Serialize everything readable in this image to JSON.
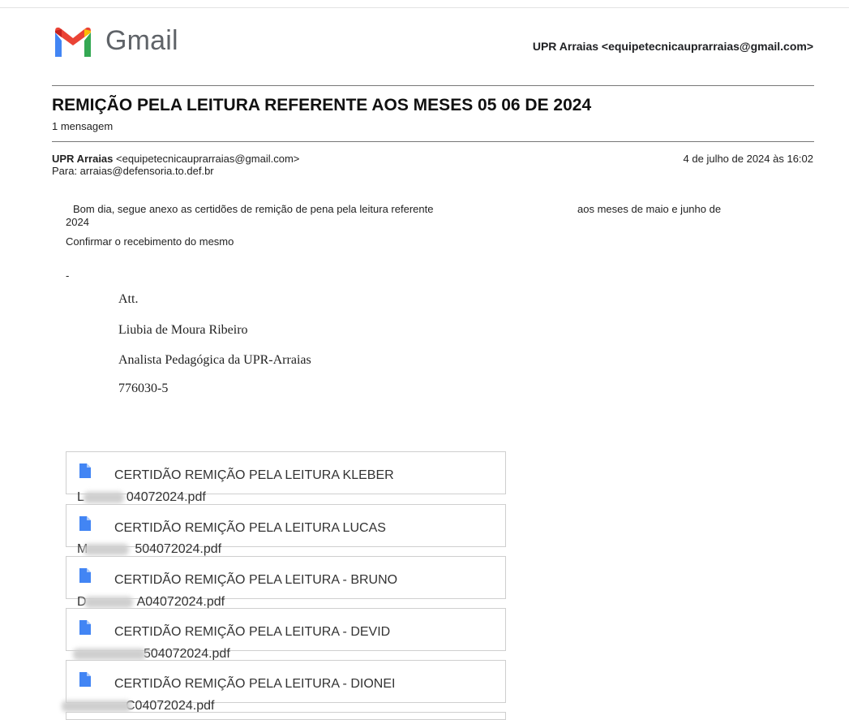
{
  "app": {
    "logo_text": "Gmail",
    "account": "UPR Arraias <equipetecnicauprarraias@gmail.com>"
  },
  "thread": {
    "subject": "REMIÇÃO PELA LEITURA REFERENTE AOS MESES 05 06 DE 2024",
    "count": "1 mensagem"
  },
  "message": {
    "sender_name": "UPR Arraias",
    "sender_email": "<equipetecnicauprarraias@gmail.com>",
    "to": "Para: arraias@defensoria.to.def.br",
    "date": "4 de julho de 2024 às 16:02",
    "body": {
      "line1a": "Bom dia, segue anexo as certidões de remição de pena pela leitura referente",
      "line1b": "aos meses de maio e junho de",
      "line2": "2024",
      "line3": "Confirmar o recebimento do mesmo",
      "dash": "-"
    },
    "signature": [
      "Att.",
      "Liubia de Moura Ribeiro",
      "Analista Pedagógica da UPR-Arraias",
      "776030-5"
    ]
  },
  "attachments": [
    {
      "name": "CERTIDÃO REMIÇÃO PELA LEITURA KLEBER",
      "file_prefix": "L",
      "file_suffix": "04072024.pdf"
    },
    {
      "name": "CERTIDÃO REMIÇÃO PELA LEITURA LUCAS",
      "file_prefix": "M",
      "file_suffix": "504072024.pdf"
    },
    {
      "name": "CERTIDÃO REMIÇÃO PELA LEITURA - BRUNO",
      "file_prefix": "D",
      "file_suffix": "A04072024.pdf"
    },
    {
      "name": "CERTIDÃO REMIÇÃO PELA LEITURA - DEVID",
      "file_prefix": "",
      "file_suffix": "504072024.pdf"
    },
    {
      "name": "CERTIDÃO REMIÇÃO PELA LEITURA - DIONEI",
      "file_prefix": "",
      "file_suffix": "C04072024.pdf"
    }
  ],
  "colors": {
    "doc_icon": "#4285f4",
    "gmail_red": "#ea4335",
    "gmail_blue": "#4285f4",
    "gmail_green": "#34a853",
    "gmail_yellow": "#fbbc04"
  }
}
